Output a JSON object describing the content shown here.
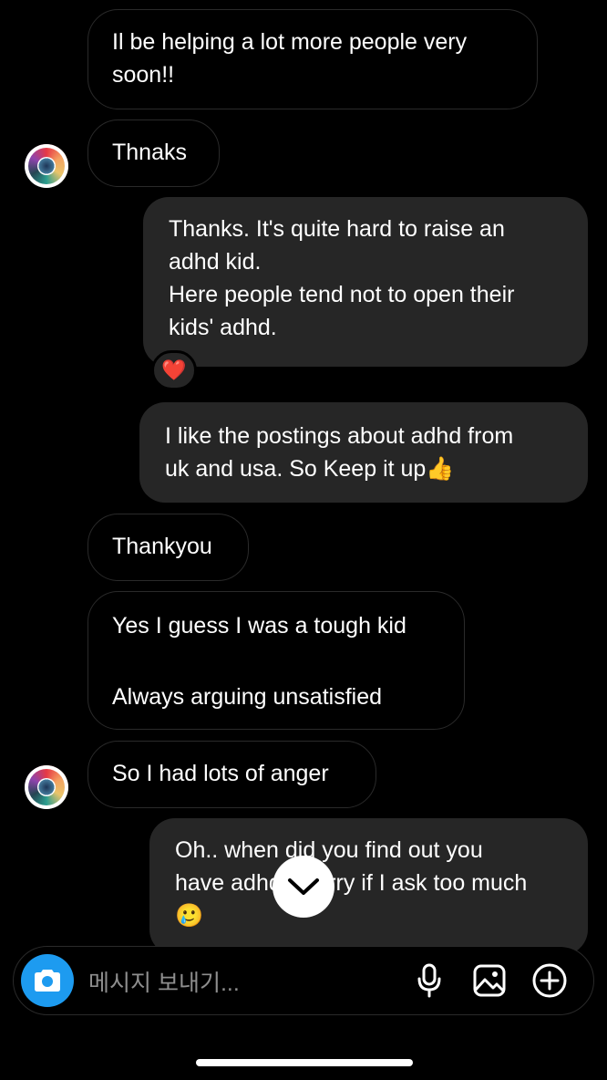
{
  "messages": [
    {
      "lines": [
        "Il be helping a lot more people very",
        "soon!!"
      ]
    },
    {
      "lines": [
        "Thnaks"
      ]
    },
    {
      "lines": [
        "Thanks. It's quite hard to raise an",
        "adhd kid.",
        "Here people tend not to open their",
        "kids' adhd."
      ],
      "reaction": "❤️"
    },
    {
      "lines": [
        "I like the postings about adhd from",
        "uk and usa. So Keep it up👍"
      ]
    },
    {
      "lines": [
        "Thankyou"
      ]
    },
    {
      "lines": [
        "Yes I guess I was a tough kid",
        "",
        "Always arguing unsatisfied"
      ]
    },
    {
      "lines": [
        "So I had lots of anger"
      ]
    },
    {
      "lines": [
        "Oh.. when did you find out you",
        "have adhd? Sorry if I ask too much",
        "🥲"
      ]
    }
  ],
  "composer": {
    "placeholder": "메시지 보내기..."
  },
  "icons": {
    "camera": "camera-icon",
    "mic": "microphone-icon",
    "gallery": "image-icon",
    "add": "plus-circle-icon",
    "scroll": "chevron-down-icon",
    "avatar": "contact-avatar"
  }
}
